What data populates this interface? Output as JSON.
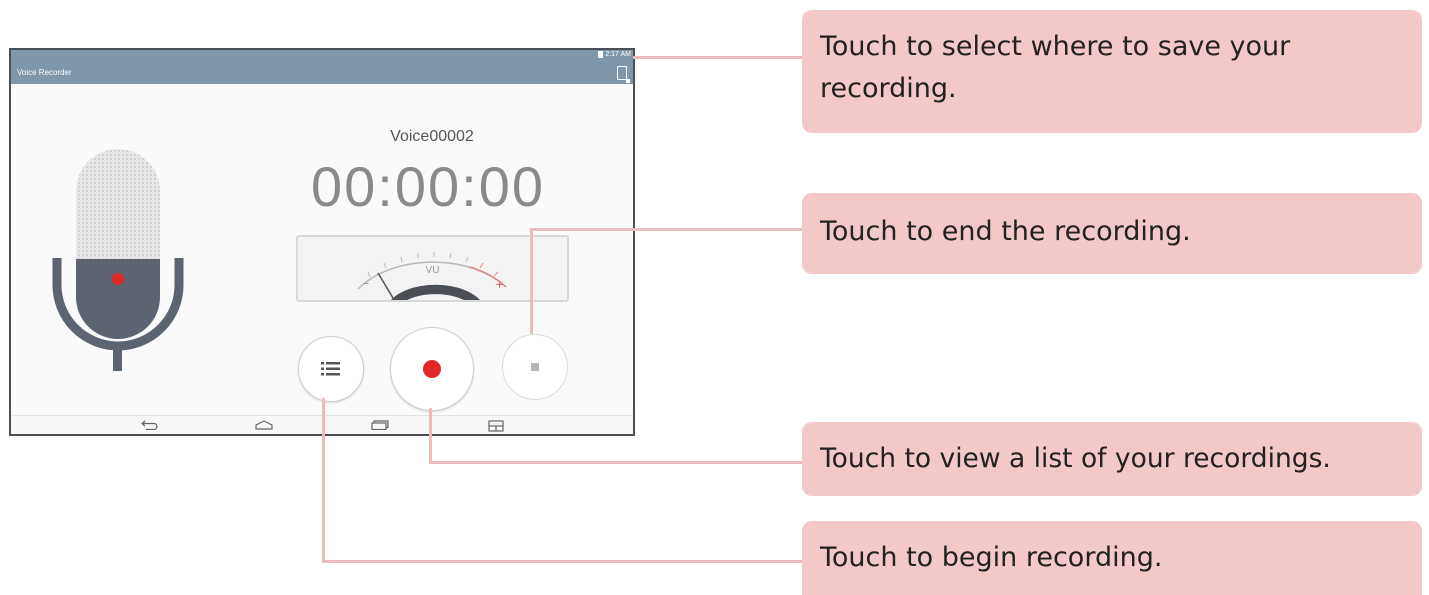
{
  "app": {
    "title": "Voice Recorder",
    "status_time": "2:17 AM"
  },
  "recorder": {
    "file_name": "Voice00002",
    "elapsed": "00:00:00",
    "meter_label": "VU",
    "meter_minus": "–",
    "meter_plus": "+"
  },
  "controls": {
    "list": "list-icon",
    "record": "record-icon",
    "stop": "stop-icon"
  },
  "nav": [
    "back-icon",
    "home-icon",
    "recent-apps-icon",
    "dual-window-icon"
  ],
  "callouts": {
    "storage": "Touch to select where to save your recording.",
    "stop": "Touch to end the recording.",
    "list": "Touch to view a list of your recordings.",
    "record": "Touch to begin recording."
  },
  "colors": {
    "app_bar": "#7f97a8",
    "record_red": "#e02626",
    "callout_bg": "#f2c8c8",
    "connector": "#ecbcbc",
    "mic_dark": "#5b6470"
  }
}
